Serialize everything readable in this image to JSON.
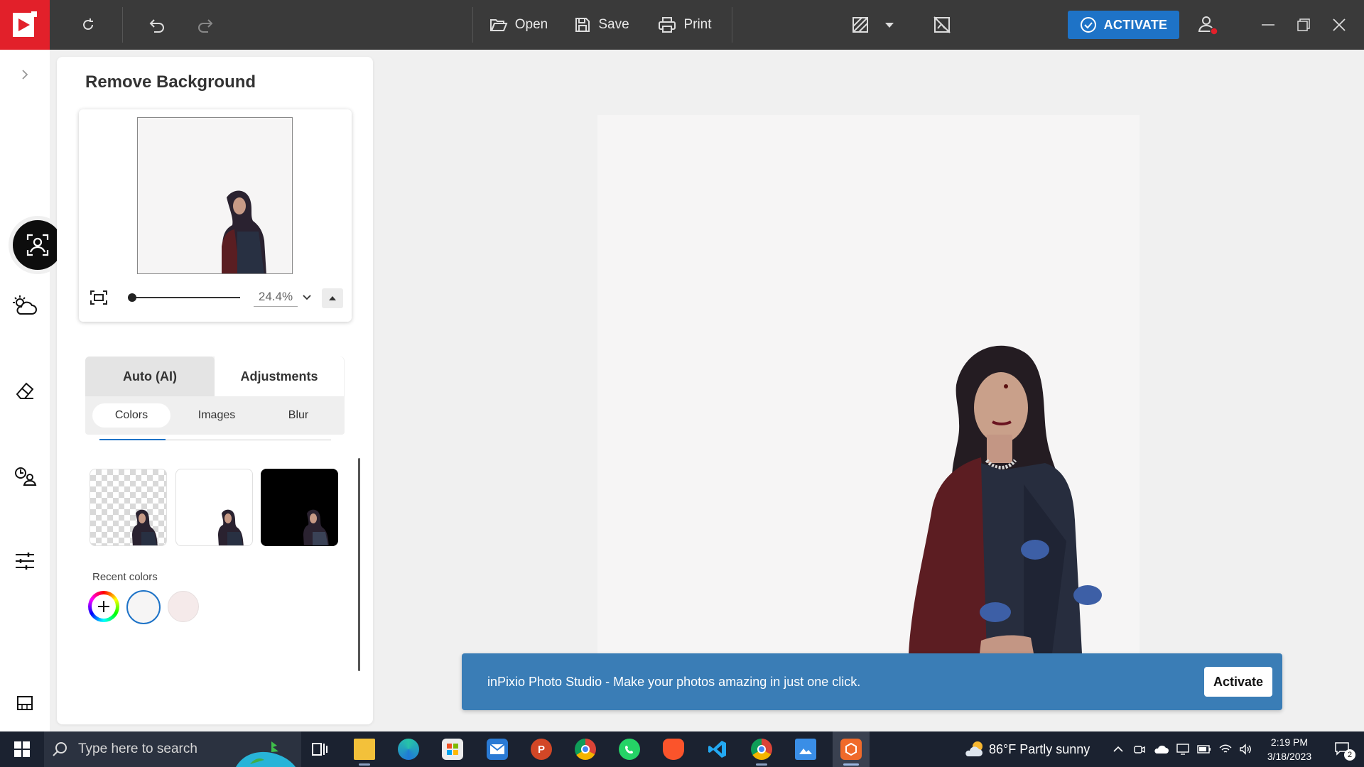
{
  "titlebar": {
    "open_label": "Open",
    "save_label": "Save",
    "print_label": "Print",
    "activate_label": "ACTIVATE"
  },
  "panel": {
    "title": "Remove Background",
    "zoom_value": "24.4%",
    "tabs": [
      "Auto (AI)",
      "Adjustments"
    ],
    "subtabs": [
      "Colors",
      "Images",
      "Blur"
    ],
    "active_tab": "Auto (AI)",
    "active_subtab": "Colors",
    "recent_colors_label": "Recent colors",
    "recent_colors": [
      "#f6f5f5",
      "#f5eaea"
    ]
  },
  "notification": {
    "text": "inPixio Photo Studio - Make your photos amazing in just one click.",
    "button": "Activate"
  },
  "taskbar": {
    "search_placeholder": "Type here to search",
    "weather": "86°F  Partly sunny",
    "time": "2:19 PM",
    "date": "3/18/2023",
    "notification_count": "2"
  },
  "colors": {
    "brand_red": "#e2202a",
    "accent_blue": "#1e73c7",
    "titlebar": "#3a3a3a",
    "notification_bg": "#3a7db6",
    "canvas_bg": "#f6f5f5"
  }
}
